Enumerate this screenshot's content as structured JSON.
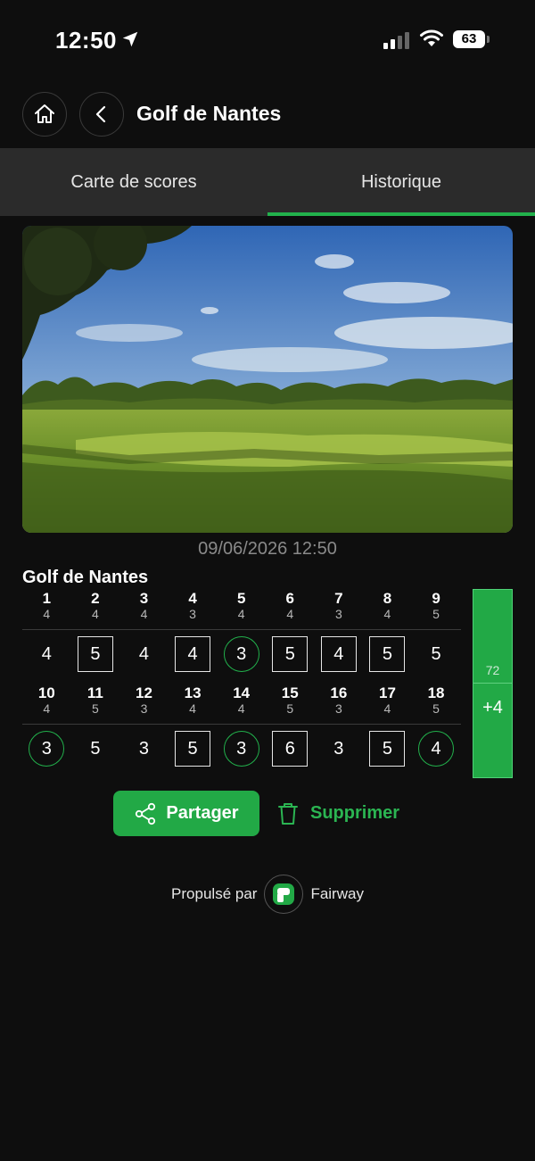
{
  "status_bar": {
    "time": "12:50",
    "battery": "63"
  },
  "header": {
    "title": "Golf de Nantes"
  },
  "tabs": [
    {
      "label": "Carte de scores",
      "active": false
    },
    {
      "label": "Historique",
      "active": true
    }
  ],
  "round": {
    "date": "09/06/2026 12:50",
    "course_name": "Golf de Nantes",
    "front": {
      "holes": [
        "1",
        "2",
        "3",
        "4",
        "5",
        "6",
        "7",
        "8",
        "9"
      ],
      "pars": [
        "4",
        "4",
        "4",
        "3",
        "4",
        "4",
        "3",
        "4",
        "5"
      ],
      "scores": [
        {
          "value": "4",
          "marker": "none"
        },
        {
          "value": "5",
          "marker": "square"
        },
        {
          "value": "4",
          "marker": "none"
        },
        {
          "value": "4",
          "marker": "square"
        },
        {
          "value": "3",
          "marker": "circle"
        },
        {
          "value": "5",
          "marker": "square"
        },
        {
          "value": "4",
          "marker": "square"
        },
        {
          "value": "5",
          "marker": "square"
        },
        {
          "value": "5",
          "marker": "none"
        }
      ]
    },
    "back": {
      "holes": [
        "10",
        "11",
        "12",
        "13",
        "14",
        "15",
        "16",
        "17",
        "18"
      ],
      "pars": [
        "4",
        "5",
        "3",
        "4",
        "4",
        "5",
        "3",
        "4",
        "5"
      ],
      "scores": [
        {
          "value": "3",
          "marker": "circle"
        },
        {
          "value": "5",
          "marker": "none"
        },
        {
          "value": "3",
          "marker": "none"
        },
        {
          "value": "5",
          "marker": "square"
        },
        {
          "value": "3",
          "marker": "circle"
        },
        {
          "value": "6",
          "marker": "square"
        },
        {
          "value": "3",
          "marker": "none"
        },
        {
          "value": "5",
          "marker": "square"
        },
        {
          "value": "4",
          "marker": "circle"
        }
      ]
    },
    "total_par": "72",
    "total_diff": "+4"
  },
  "actions": {
    "share_label": "Partager",
    "delete_label": "Supprimer"
  },
  "footer": {
    "powered_by": "Propulsé par",
    "brand": "Fairway"
  },
  "colors": {
    "accent": "#22a946",
    "background": "#0e0e0e",
    "tab_bar": "#2b2b2b"
  }
}
